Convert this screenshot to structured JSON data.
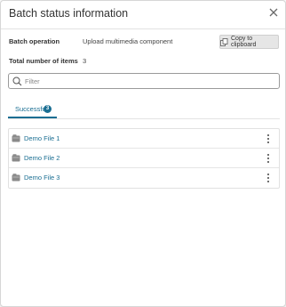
{
  "dialog": {
    "title": "Batch status information",
    "close_icon": "close-icon"
  },
  "info": {
    "batch_operation_label": "Batch operation",
    "batch_operation_value": "Upload multimedia component",
    "total_items_label": "Total number of items",
    "total_items_value": "3"
  },
  "copy_button": {
    "label": "Copy to clipboard",
    "icon": "copy-icon"
  },
  "filter": {
    "placeholder": "Filter",
    "value": "",
    "icon": "search-icon"
  },
  "tabs": [
    {
      "label": "Successful",
      "badge": "3",
      "active": true
    }
  ],
  "items": [
    {
      "name": "Demo File 1",
      "icon": "multimedia-file-icon"
    },
    {
      "name": "Demo File 2",
      "icon": "multimedia-file-icon"
    },
    {
      "name": "Demo File 3",
      "icon": "multimedia-file-icon"
    }
  ],
  "colors": {
    "accent": "#1a6e92",
    "text": "#333333",
    "border": "#e1e1e1",
    "button_bg": "#e6e6e6"
  }
}
